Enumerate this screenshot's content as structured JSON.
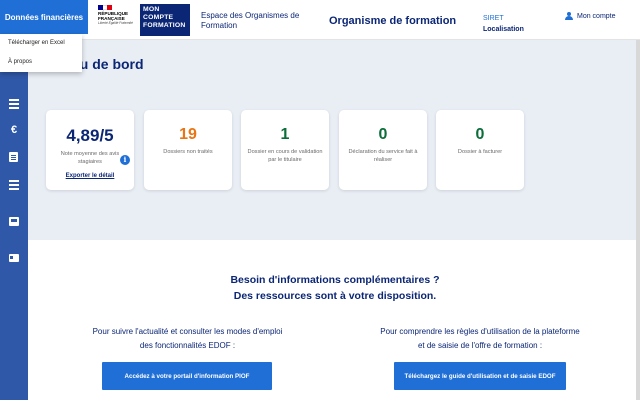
{
  "header": {
    "finance_button": "Données financières",
    "marianne": {
      "line1": "RÉPUBLIQUE",
      "line2": "FRANÇAISE",
      "devise": "Liberté Égalité Fraternité",
      "flag_colors": [
        "#000091",
        "#ffffff",
        "#e1000f"
      ]
    },
    "mcf_logo": [
      "MON",
      "COMPTE",
      "FORMATION"
    ],
    "eof_title": "Espace des Organismes de Formation",
    "org_title": "Organisme de formation",
    "siret_label": "SIRET",
    "localisation_label": "Localisation",
    "account_label": "Mon compte"
  },
  "dropdown": {
    "items": [
      "Télécharger en Excel",
      "À propos"
    ]
  },
  "sidebar": {
    "icons": [
      "dashboard-icon",
      "list-icon",
      "euro-icon",
      "clipboard-icon",
      "rows-icon",
      "inbox-icon",
      "id-card-icon"
    ]
  },
  "dashboard": {
    "title": "au de bord",
    "cards": [
      {
        "value": "4,89/5",
        "label": "Note moyenne des avis stagiaires",
        "link": "Exporter le détail"
      },
      {
        "value": "19",
        "label": "Dossiers non traités"
      },
      {
        "value": "1",
        "label": "Dossier en cours de validation par le titulaire"
      },
      {
        "value": "0",
        "label": "Déclaration du service fait à réaliser"
      },
      {
        "value": "0",
        "label": "Dossier à facturer"
      }
    ],
    "info_icon": "i"
  },
  "info": {
    "heading_line1": "Besoin d'informations complémentaires ?",
    "heading_line2": "Des ressources sont à votre disposition.",
    "left_text": "Pour suivre l'actualité et consulter les modes d'emploi des fonctionnalités EDOF :",
    "right_text": "Pour comprendre les règles d'utilisation de la plateforme et de saisie de l'offre de formation :",
    "left_button": "Accédez à votre portail d'information PIOF",
    "right_button": "Téléchargez le guide d'utilisation et de saisie EDOF"
  },
  "colors": {
    "primary": "#1f6fd6",
    "navy": "#0b2675",
    "sidebar": "#2f58a8",
    "orange": "#e87614",
    "green": "#0b6e3a"
  }
}
